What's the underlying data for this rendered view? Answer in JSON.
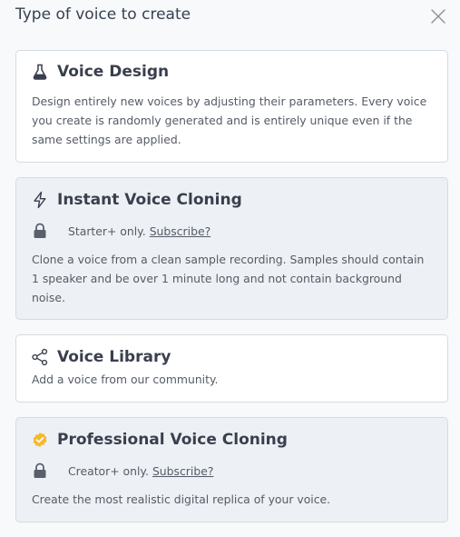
{
  "dialog": {
    "title": "Type of voice to create",
    "close_icon": "close-icon"
  },
  "options": [
    {
      "icon": "flask-icon",
      "title": "Voice Design",
      "description": "Design entirely new voices by adjusting their parameters. Every voice you create is randomly generated and is entirely unique even if the same settings are applied."
    },
    {
      "icon": "lightning-icon",
      "title": "Instant Voice Cloning",
      "lock_icon": "lock-icon",
      "requirement": "Starter+ only.",
      "subscribe_label": "Subscribe?",
      "description": "Clone a voice from a clean sample recording. Samples should contain 1 speaker and be over 1 minute long and not contain background noise."
    },
    {
      "icon": "share-icon",
      "title": "Voice Library",
      "description": "Add a voice from our community."
    },
    {
      "icon": "verified-badge-icon",
      "title": "Professional Voice Cloning",
      "lock_icon": "lock-icon",
      "requirement": "Creator+ only.",
      "subscribe_label": "Subscribe?",
      "description": "Create the most realistic digital replica of your voice."
    }
  ],
  "colors": {
    "background": "#f7f9fa",
    "card": "#ffffff",
    "card_locked": "#edf1f5",
    "badge": "#f5b82e"
  }
}
